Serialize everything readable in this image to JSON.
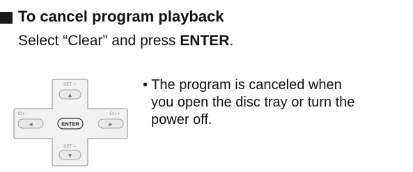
{
  "section": {
    "heading": "To cancel program playback",
    "instruction_prefix": "Select “Clear” and press ",
    "instruction_key": "ENTER",
    "instruction_suffix": "."
  },
  "remote": {
    "set_plus_label": "SET +",
    "set_minus_label": "SET –",
    "ch_minus_label": "CH –",
    "ch_plus_label": "CH +",
    "enter_label": "ENTER",
    "up_glyph": "▲",
    "down_glyph": "▼",
    "left_glyph": "◀",
    "right_glyph": "▶"
  },
  "note": {
    "bullet": "•",
    "line1": "The program is canceled when",
    "line2": "you open the disc tray or turn the",
    "line3": "power off."
  },
  "colors": {
    "bullet_square": "#1a1a1a",
    "pad_fill": "#f2f2f2",
    "pad_border": "#8a8a8a",
    "button_fill": "#e9e9e9"
  }
}
